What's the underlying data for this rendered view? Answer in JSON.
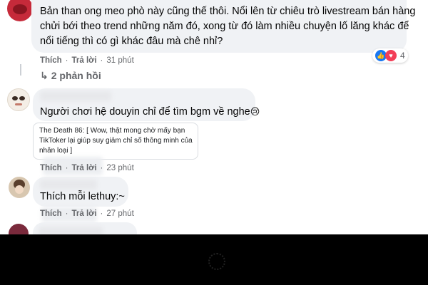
{
  "comments": [
    {
      "text_line1": "Bản than ong meo phò này cũng thế thôi. Nổi lên từ chiêu trò livestream bán hàng",
      "text_line2": "chửi bới theo trend những năm đó, xong từ đó làm nhiều chuyện lố lăng khác để",
      "text_line3": "nổi tiếng thì có gì khác đâu mà chê nhỉ?",
      "like_label": "Thích",
      "reply_label": "Trả lời",
      "time": "31 phút",
      "reaction_count": "4",
      "replies_toggle": "2 phản hồi"
    },
    {
      "text": "Người chơi hệ douyin chỉ để tìm bgm về nghe",
      "emoji": "😢",
      "embedded_line1": "The Death 86: [ Wow, thật mong chờ mấy bạn",
      "embedded_line2": "TikToker lại giúp suy giảm chỉ số thông minh của",
      "embedded_line3": "nhân loại ]",
      "like_label": "Thích",
      "reply_label": "Trả lời",
      "time": "23 phút"
    },
    {
      "text": "Thích mỗi lethuy:~",
      "like_label": "Thích",
      "reply_label": "Trả lời",
      "time": "27 phút"
    }
  ],
  "colors": {
    "bubble": "#f0f2f5",
    "meta": "#65676b",
    "video_bar": "#000000",
    "like_reaction": "#1877f2",
    "love_reaction": "#f33e58"
  }
}
